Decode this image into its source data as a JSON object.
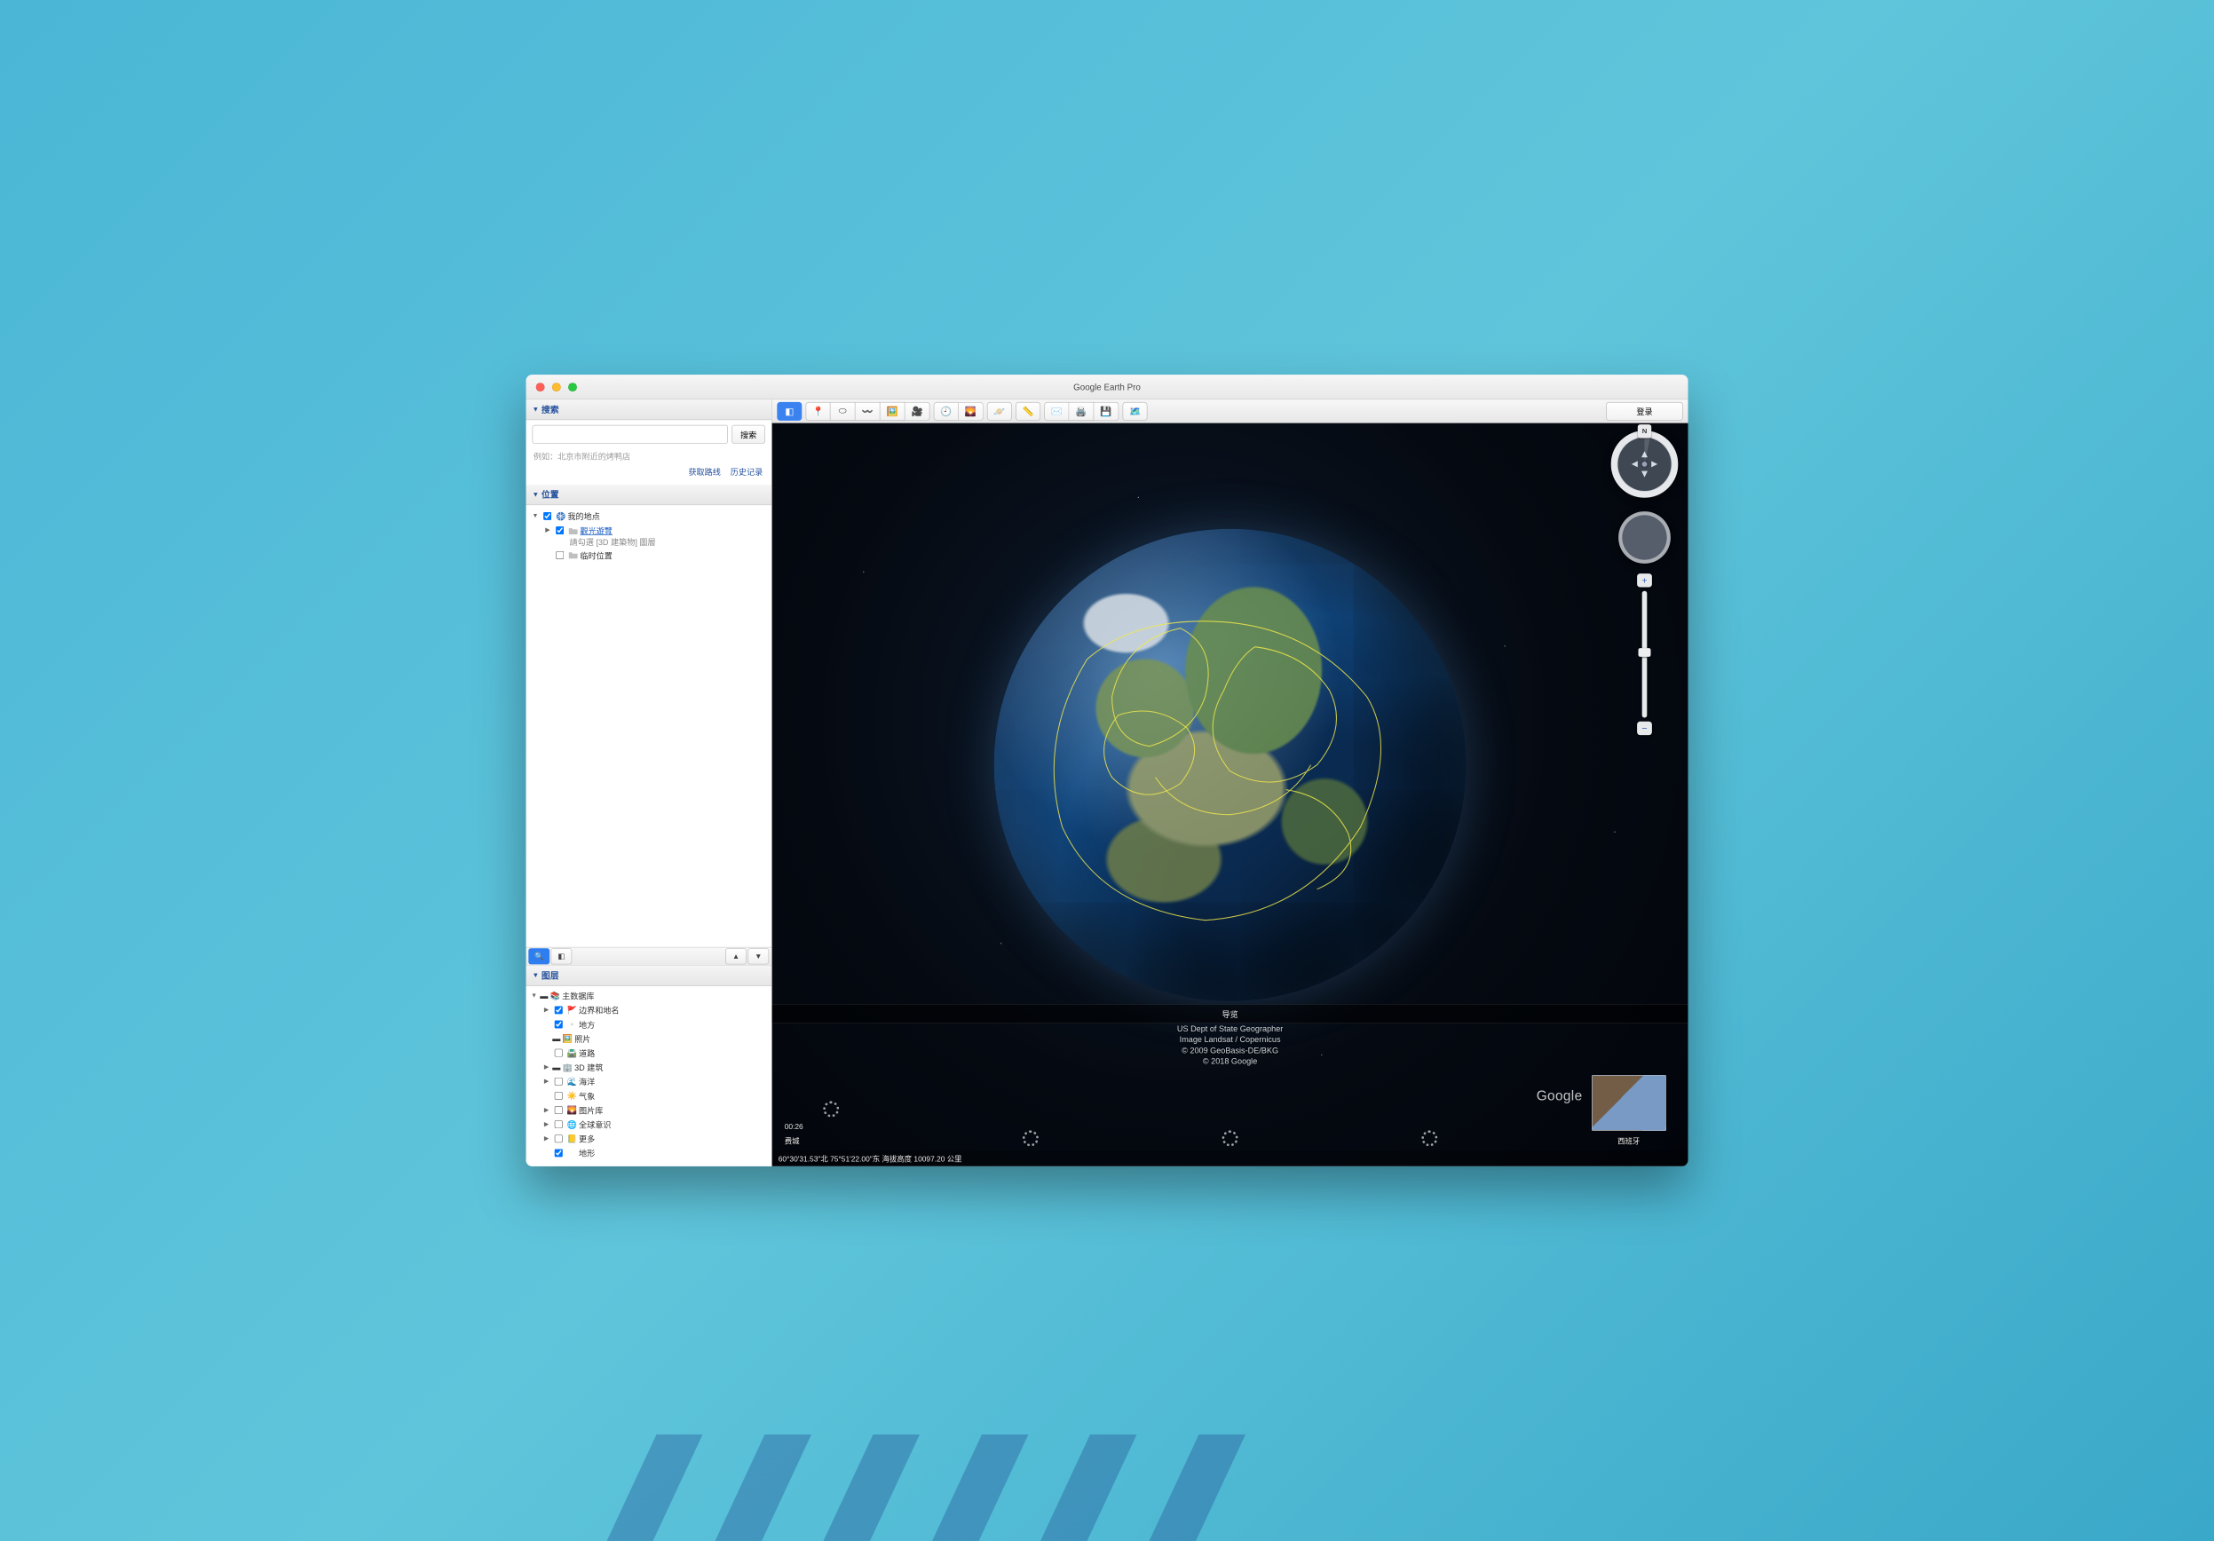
{
  "window": {
    "title": "Google Earth Pro"
  },
  "toolbar": {
    "signin": "登录",
    "tools": {
      "sidebar_toggle": "sidebar-toggle",
      "placemark": "placemark",
      "polygon": "polygon",
      "path": "path",
      "image_overlay": "image-overlay",
      "record_tour": "record-tour",
      "historical": "historical-imagery",
      "sunlight": "sunlight",
      "planets": "planets",
      "ruler": "ruler",
      "email": "email",
      "print": "print",
      "save_image": "save-image",
      "view_in_maps": "view-in-maps"
    }
  },
  "sidebar": {
    "search": {
      "title": "搜索",
      "button": "搜索",
      "placeholder": "",
      "hint": "例如：北京市附近的烤鸭店",
      "get_directions": "获取路线",
      "history": "历史记录"
    },
    "places": {
      "title": "位置",
      "my_places": "我的地点",
      "sightseeing": "觀光遊覽",
      "sightseeing_hint": "請勾選 [3D 建築物] 圖層",
      "temp_places": "临时位置"
    },
    "layers": {
      "title": "图层",
      "root": "主数据库",
      "items": [
        {
          "label": "边界和地名",
          "checked": true,
          "expandable": true,
          "icon": "flag"
        },
        {
          "label": "地方",
          "checked": true,
          "expandable": false,
          "icon": "square"
        },
        {
          "label": "照片",
          "checked": false,
          "expandable": false,
          "icon": "photo",
          "tristate": true
        },
        {
          "label": "道路",
          "checked": false,
          "expandable": false,
          "icon": "road"
        },
        {
          "label": "3D 建筑",
          "checked": false,
          "expandable": true,
          "icon": "building",
          "tristate": true
        },
        {
          "label": "海洋",
          "checked": false,
          "expandable": true,
          "icon": "ocean"
        },
        {
          "label": "气象",
          "checked": false,
          "expandable": false,
          "icon": "weather"
        },
        {
          "label": "图片库",
          "checked": false,
          "expandable": true,
          "icon": "gallery"
        },
        {
          "label": "全球意识",
          "checked": false,
          "expandable": true,
          "icon": "globe"
        },
        {
          "label": "更多",
          "checked": false,
          "expandable": true,
          "icon": "note"
        },
        {
          "label": "地形",
          "checked": true,
          "expandable": false,
          "icon": ""
        }
      ]
    }
  },
  "viewport": {
    "tour_title": "导览",
    "clip_time": "00:26",
    "clip1_label": "费城",
    "clip_last_label": "西班牙",
    "attribution": [
      "US Dept of State Geographer",
      "Image Landsat / Copernicus",
      "© 2009 GeoBasis-DE/BKG",
      "© 2018 Google"
    ],
    "google_logo": "Google",
    "status": "60°30'31.53\"北  75°51'22.00\"东      海拔高度 10097.20 公里",
    "nav_compass": "N"
  }
}
